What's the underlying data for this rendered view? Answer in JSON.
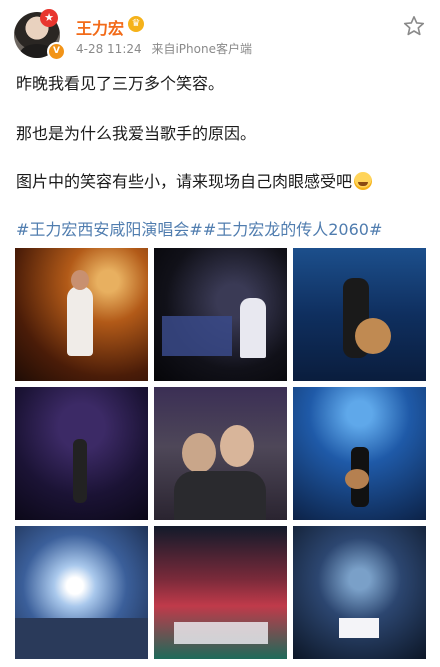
{
  "post": {
    "author": "王力宏",
    "time": "4-28 11:24",
    "source": "来自iPhone客户端",
    "lines": [
      "昨晚我看见了三万多个笑容。",
      "那也是为什么我爱当歌手的原因。",
      "图片中的笑容有些小，请来现场自己肉眼感受吧"
    ],
    "hashtags": "#王力宏西安咸阳演唱会##王力宏龙的传人2060#"
  },
  "colors": {
    "name": "#f26a18",
    "hashtag": "#507daf",
    "meta": "#8a8a8a"
  },
  "icons": {
    "follow": "star-outline-icon",
    "emoji": "laughing-emoji-icon",
    "verified": "verified-badge-icon",
    "vip": "crown-icon"
  },
  "photos": [
    "concert-violin",
    "concert-piano",
    "concert-guitar-spotlight",
    "concert-crowd-purple",
    "fans-photo",
    "concert-guitar-blue",
    "stadium-lights",
    "stage-dancers",
    "stage-piano-lights"
  ]
}
